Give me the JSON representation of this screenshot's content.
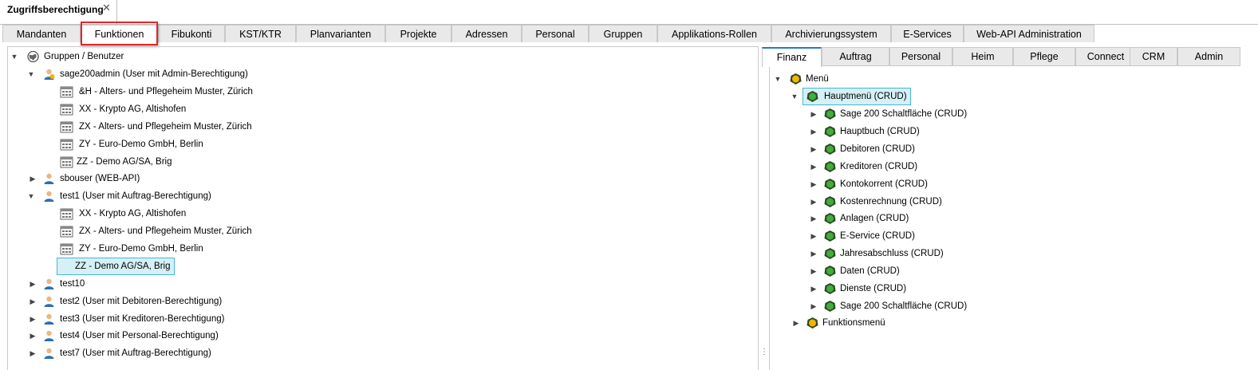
{
  "window": {
    "tab_title": "Zugriffsberechtigung",
    "close_glyph": "✕"
  },
  "main_tabs": [
    {
      "label": "Mandanten"
    },
    {
      "label": "Funktionen"
    },
    {
      "label": "Fibukonti"
    },
    {
      "label": "KST/KTR"
    },
    {
      "label": "Planvarianten"
    },
    {
      "label": "Projekte"
    },
    {
      "label": "Adressen"
    },
    {
      "label": "Personal"
    },
    {
      "label": "Gruppen"
    },
    {
      "label": "Applikations-Rollen"
    },
    {
      "label": "Archivierungssystem"
    },
    {
      "label": "E-Services"
    },
    {
      "label": "Web-API Administration"
    }
  ],
  "active_main_tab": "Funktionen",
  "left_tree": {
    "root": "Gruppen / Benutzer",
    "users": [
      {
        "label": "sage200admin (User mit Admin-Berechtigung)",
        "expanded": true,
        "children": [
          "&H - Alters- und Pflegeheim Muster, Zürich",
          "XX - Krypto AG, Altishofen",
          "ZX - Alters- und Pflegeheim Muster, Zürich",
          "ZY - Euro-Demo GmbH, Berlin",
          "ZZ - Demo AG/SA, Brig"
        ]
      },
      {
        "label": "sbouser (WEB-API)",
        "expanded": false,
        "children": []
      },
      {
        "label": "test1 (User mit Auftrag-Berechtigung)",
        "expanded": true,
        "children": [
          "XX - Krypto AG, Altishofen",
          "ZX - Alters- und Pflegeheim Muster, Zürich",
          "ZY - Euro-Demo GmbH, Berlin",
          "ZZ - Demo AG/SA, Brig"
        ]
      },
      {
        "label": "test10",
        "expanded": false,
        "children": []
      },
      {
        "label": "test2 (User mit Debitoren-Berechtigung)",
        "expanded": false,
        "children": []
      },
      {
        "label": "test3 (User mit Kreditoren-Berechtigung)",
        "expanded": false,
        "children": []
      },
      {
        "label": "test4 (User mit Personal-Berechtigung)",
        "expanded": false,
        "children": []
      },
      {
        "label": "test7 (User mit Auftrag-Berechtigung)",
        "expanded": false,
        "children": []
      }
    ],
    "selected": "ZZ - Demo AG/SA, Brig"
  },
  "right_tabs": [
    {
      "label": "Finanz"
    },
    {
      "label": "Auftrag"
    },
    {
      "label": "Personal"
    },
    {
      "label": "Heim"
    },
    {
      "label": "Pflege"
    },
    {
      "label": "Connect"
    },
    {
      "label": "CRM"
    },
    {
      "label": "Admin"
    }
  ],
  "active_right_tab": "Finanz",
  "right_tree": {
    "root": "Menü",
    "main_menu": "Hauptmenü (CRUD)",
    "items": [
      "Sage 200 Schaltfläche (CRUD)",
      "Hauptbuch (CRUD)",
      "Debitoren (CRUD)",
      "Kreditoren (CRUD)",
      "Kontokorrent (CRUD)",
      "Kostenrechnung (CRUD)",
      "Anlagen (CRUD)",
      "E-Service (CRUD)",
      "Jahresabschluss (CRUD)",
      "Daten (CRUD)",
      "Dienste (CRUD)",
      "Sage 200 Schaltfläche (CRUD)"
    ],
    "function_menu": "Funktionsmenü"
  },
  "colors": {
    "highlight": "#e3262b",
    "selection_bg": "#d5f0f7",
    "selection_border": "#47b6d5",
    "tab_active_top": "#2a7ab8"
  },
  "icons": [
    "globe-icon",
    "admin-user-icon",
    "user-icon",
    "company-icon",
    "traffic-light-green-icon",
    "traffic-light-yellow-icon",
    "expand-arrow-icon",
    "collapse-arrow-icon"
  ]
}
